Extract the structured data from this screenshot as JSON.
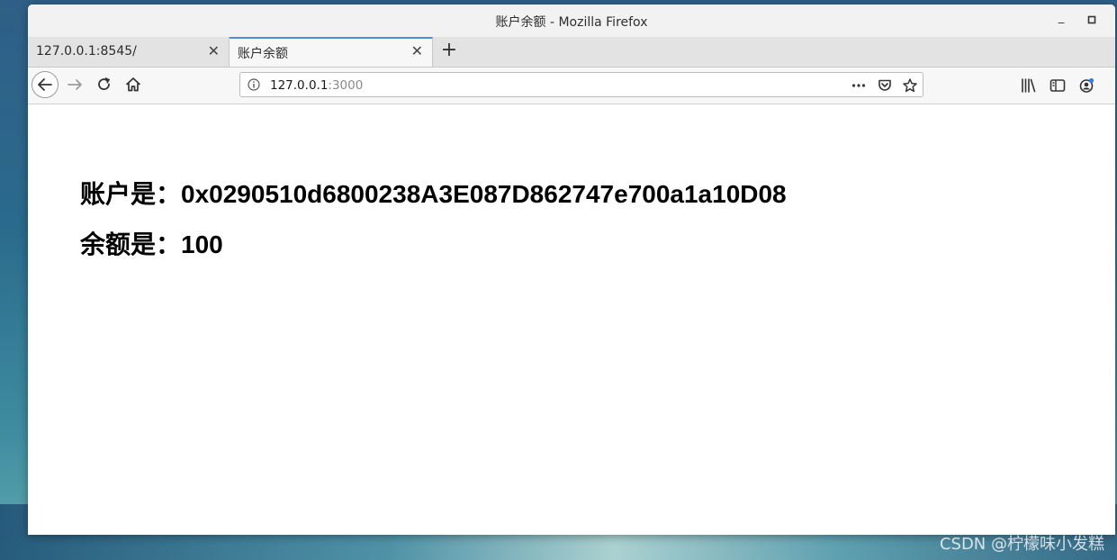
{
  "window": {
    "title": "账户余额 - Mozilla Firefox",
    "minimize_glyph": "_",
    "maximize_glyph": "▫"
  },
  "tabs": [
    {
      "label": "127.0.0.1:8545/",
      "active": false,
      "close_glyph": "✕"
    },
    {
      "label": "账户余额",
      "active": true,
      "close_glyph": "✕"
    }
  ],
  "newtab_glyph": "+",
  "navbar": {
    "url_host": "127.0.0.1",
    "url_port": ":3000",
    "icons": [
      "back-arrow-icon",
      "forward-arrow-icon",
      "reload-icon",
      "home-icon",
      "info-icon",
      "page-actions-icon",
      "pocket-icon",
      "bookmark-star-icon",
      "library-icon",
      "sidebar-icon",
      "account-icon"
    ]
  },
  "content": {
    "account_label": "账户是：",
    "account_value": "0x0290510d6800238A3E087D862747e700a1a10D08",
    "balance_label": "余额是：",
    "balance_value": "100"
  },
  "watermark": "CSDN @柠檬味小发糕",
  "colors": {
    "active_tab_accent": "#4a90d9",
    "titlebar_bg": "#f2f2f2",
    "tabstrip_bg": "#e3e3e3",
    "navbar_bg": "#f7f7f7"
  }
}
